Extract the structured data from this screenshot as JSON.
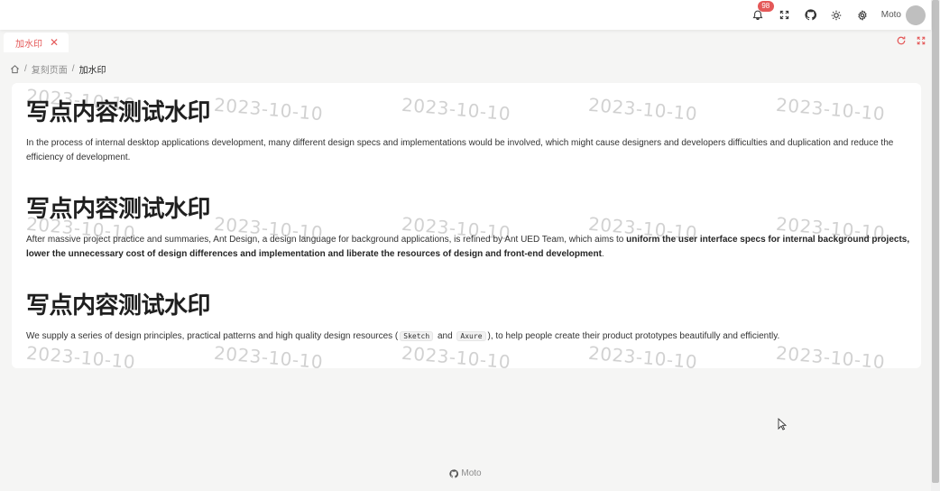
{
  "header": {
    "notification_count": "98",
    "user_name": "Moto"
  },
  "tabs": [
    {
      "label": "加水印"
    }
  ],
  "breadcrumb": {
    "parent": "复刻页面",
    "current": "加水印"
  },
  "content": {
    "watermark_text": "2023-10-10",
    "sections": [
      {
        "title": "写点内容测试水印",
        "text": "In the process of internal desktop applications development, many different design specs and implementations would be involved, which might cause designers and developers difficulties and duplication and reduce the efficiency of development."
      },
      {
        "title": "写点内容测试水印",
        "text_pre": "After massive project practice and summaries, Ant Design, a design language for background applications, is refined by Ant UED Team, which aims to ",
        "text_bold": "uniform the user interface specs for internal background projects, lower the unnecessary cost of design differences and implementation and liberate the resources of design and front-end development",
        "text_post": "."
      },
      {
        "title": "写点内容测试水印",
        "text_pre": "We supply a series of design principles, practical patterns and high quality design resources (",
        "code1": "Sketch",
        "text_mid": " and ",
        "code2": "Axure",
        "text_post": "), to help people create their product prototypes beautifully and efficiently."
      }
    ]
  },
  "footer": {
    "label": "Moto"
  },
  "colors": {
    "accent": "#e45858",
    "background": "#f5f5f4",
    "card": "#ffffff"
  }
}
